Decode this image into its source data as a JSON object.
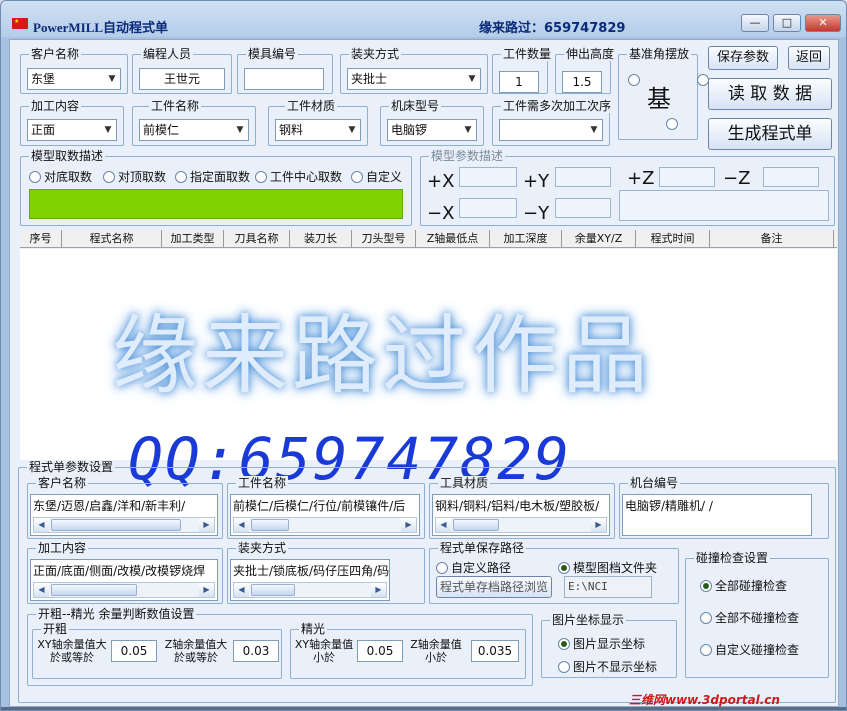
{
  "window": {
    "title": "PowerMILL自动程式单",
    "credit": "缘来路过：659747829",
    "min": "—",
    "max": "□",
    "close": "✕"
  },
  "header": {
    "customer": {
      "label": "客户名称",
      "value": "东堡"
    },
    "programmer": {
      "label": "编程人员",
      "value": "王世元"
    },
    "mold_no": {
      "label": "模具编号",
      "value": ""
    },
    "fixture": {
      "label": "装夹方式",
      "value": "夹批士"
    },
    "qty": {
      "label": "工件数量",
      "value": "1"
    },
    "extend": {
      "label": "伸出高度",
      "value": "1.5"
    },
    "datum": {
      "label": "基准角摆放",
      "glyph": "基"
    },
    "content": {
      "label": "加工内容",
      "value": "正面"
    },
    "part_name": {
      "label": "工件名称",
      "value": "前模仁"
    },
    "material": {
      "label": "工件材质",
      "value": "钢料"
    },
    "machine": {
      "label": "机床型号",
      "value": "电脑锣"
    },
    "multi": {
      "label": "工件需多次加工次序",
      "value": ""
    }
  },
  "buttons": {
    "save": "保存参数",
    "back": "返回",
    "read": "读 取 数 据",
    "generate": "生成程式单"
  },
  "fetch": {
    "label": "模型取数描述",
    "options": [
      "对底取数",
      "对顶取数",
      "指定面取数",
      "工件中心取数",
      "自定义"
    ]
  },
  "params": {
    "label": "模型参数描述",
    "px": "+X",
    "py": "+Y",
    "pz": "+Z",
    "nz": "−Z",
    "nx": "−X",
    "ny": "−Y"
  },
  "table": {
    "columns": [
      "序号",
      "程式名称",
      "加工类型",
      "刀具名称",
      "装刀长",
      "刀头型号",
      "Z轴最低点",
      "加工深度",
      "余量XY/Z",
      "程式时间",
      "备注"
    ]
  },
  "watermark": {
    "line1": "缘来路过作品",
    "line2": "QQ:659747829"
  },
  "settings": {
    "label": "程式单参数设置",
    "customer": {
      "label": "客户名称",
      "text": "东堡/迈恩/启鑫/洋和/新丰利/"
    },
    "part": {
      "label": "工件名称",
      "text": "前模仁/后模仁/行位/前模镶件/后"
    },
    "material": {
      "label": "工具材质",
      "text": "钢料/铜料/铝料/电木板/塑胶板/"
    },
    "machine": {
      "label": "机台编号",
      "text": "电脑锣/精雕机/    /"
    },
    "content": {
      "label": "加工内容",
      "text": "正面/底面/侧面/改模/改模锣烧焊"
    },
    "fixture": {
      "label": "装夹方式",
      "text": "夹批士/锁底板/码仔压四角/码"
    },
    "path": {
      "label": "程式单保存路径",
      "custom": "自定义路径",
      "model": "模型图档文件夹",
      "value": "E:\\NCI",
      "browse": "程式单存档路径浏览"
    },
    "collision": {
      "label": "碰撞检查设置",
      "all": "全部碰撞检查",
      "none": "全部不碰撞检查",
      "custom": "自定义碰撞检查"
    },
    "coord": {
      "label": "图片坐标显示",
      "show": "图片显示坐标",
      "hide": "图片不显示坐标"
    },
    "allowance": {
      "label": "开粗--精光 余量判断数值设置",
      "rough": {
        "label": "开粗",
        "xy_label": "XY轴余量值大於或等於",
        "xy_value": "0.05",
        "z_label": "Z轴余量值大於或等於",
        "z_value": "0.03"
      },
      "finish": {
        "label": "精光",
        "xy_label": "XY轴余量值小於",
        "xy_value": "0.05",
        "z_label": "Z轴余量值小於",
        "z_value": "0.035"
      }
    }
  },
  "footer": "三维网www.3dportal.cn"
}
